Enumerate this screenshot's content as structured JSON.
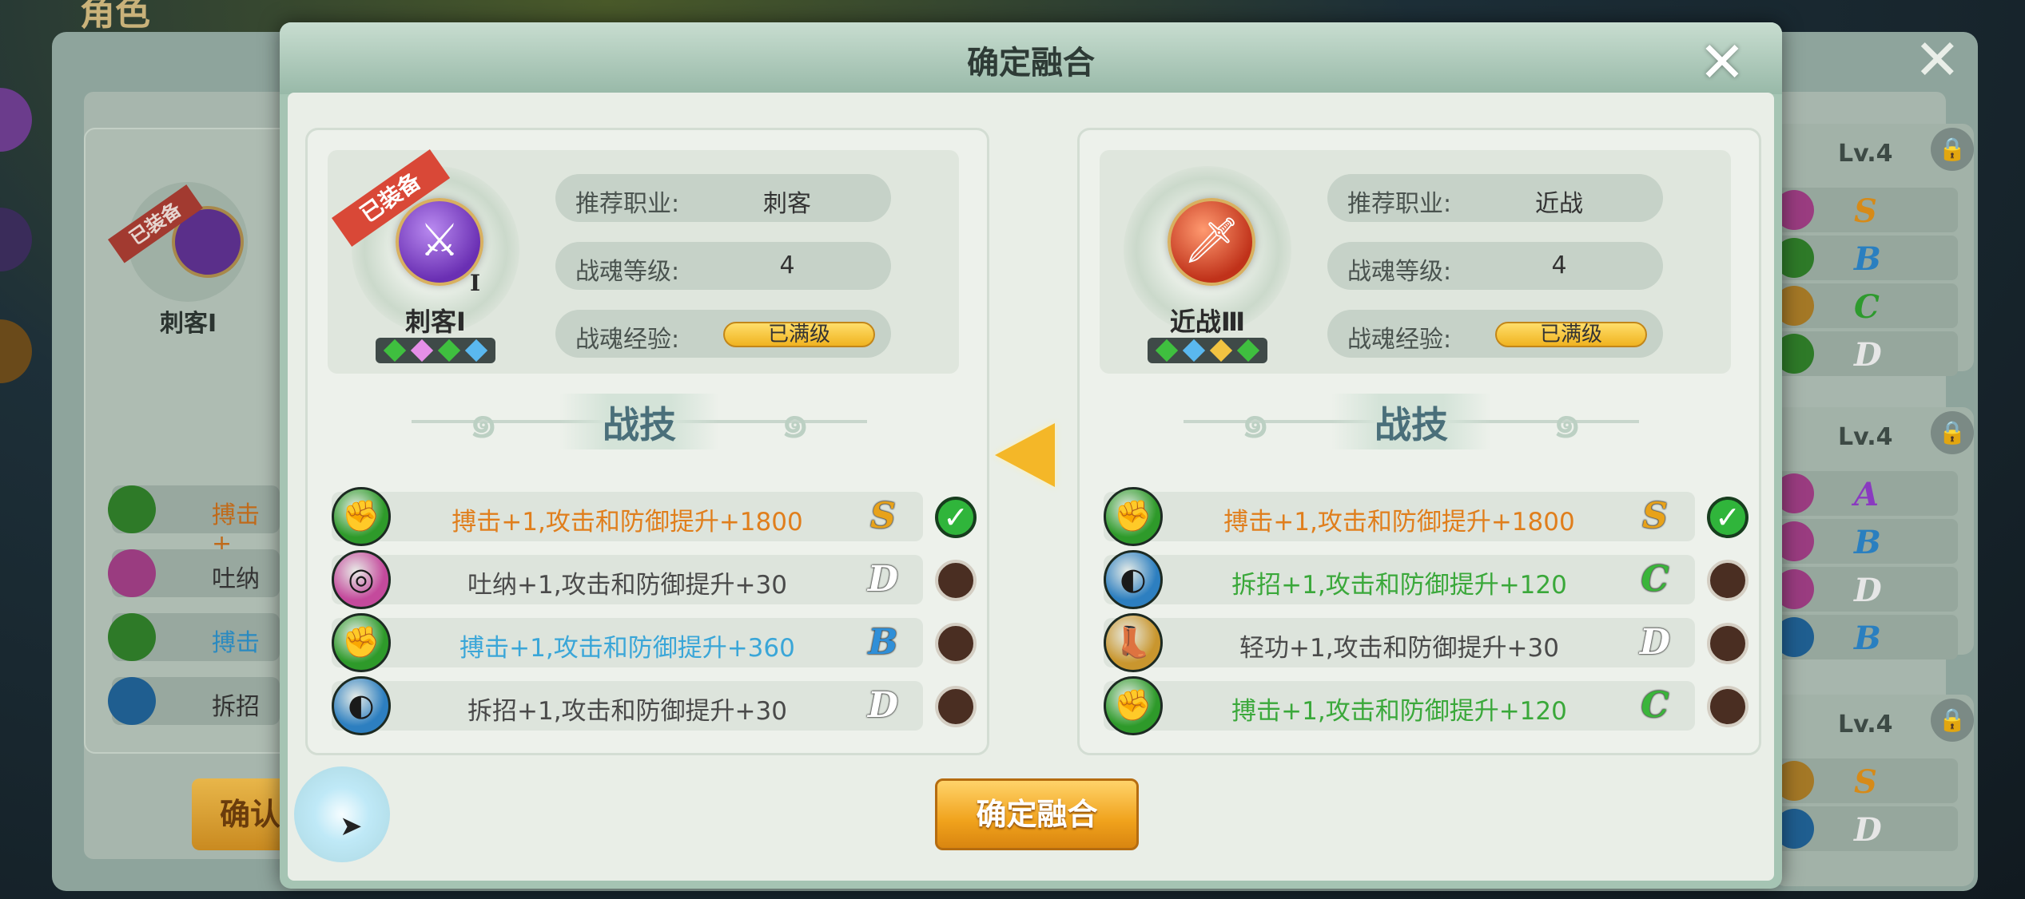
{
  "background": {
    "title_partial": "角色",
    "confirm_partial": "确认",
    "left_card": {
      "class_name": "刺客Ⅰ",
      "ribbon": "已装备",
      "rows": [
        "搏击+",
        "吐纳",
        "搏击",
        "拆招"
      ]
    },
    "right_columns": [
      {
        "level": "Lv.4",
        "grades": [
          "S",
          "B",
          "C",
          "D"
        ]
      },
      {
        "level": "Lv.4",
        "grades": [
          "A",
          "B",
          "D",
          "B"
        ]
      },
      {
        "level": "Lv.4",
        "grades": [
          "S",
          "D"
        ]
      }
    ]
  },
  "dialog": {
    "title": "确定融合",
    "close_icon": "close-x-icon",
    "confirm_label": "确定融合",
    "arrow_icon": "arrow-left-icon"
  },
  "left": {
    "ribbon": "已装备",
    "class_name": "刺客Ⅰ",
    "roman": "Ⅰ",
    "medal_icon": "crossed-daggers-icon",
    "gems": [
      "#3fbf3f",
      "#e58fe8",
      "#3fbf3f",
      "#5ab8ef"
    ],
    "stats": {
      "job_label": "推荐职业:",
      "job_value": "刺客",
      "level_label": "战魂等级:",
      "level_value": "4",
      "exp_label": "战魂经验:",
      "exp_value": "已满级"
    },
    "skills_title": "战技",
    "skills": [
      {
        "text": "搏击+1,攻击和防御提升+1800",
        "grade": "S",
        "color": "#e07e1c",
        "icon": "fist-icon",
        "icon_color": "#2e9a2a",
        "grade_color": "#e8a21a",
        "selected": true
      },
      {
        "text": "吐纳+1,攻击和防御提升+30",
        "grade": "D",
        "color": "#4a4a4a",
        "icon": "swirl-icon",
        "icon_color": "#c44a9c",
        "grade_color": "#ffffff",
        "selected": false
      },
      {
        "text": "搏击+1,攻击和防御提升+360",
        "grade": "B",
        "color": "#3aa6d8",
        "icon": "fist-icon",
        "icon_color": "#2e9a2a",
        "grade_color": "#2f8fd8",
        "selected": false
      },
      {
        "text": "拆招+1,攻击和防御提升+30",
        "grade": "D",
        "color": "#4a4a4a",
        "icon": "parry-icon",
        "icon_color": "#2d7fc0",
        "grade_color": "#ffffff",
        "selected": false
      }
    ]
  },
  "right": {
    "class_name": "近战Ⅲ",
    "medal_icon": "sword-icon",
    "gems": [
      "#3fbf3f",
      "#5ab8ef",
      "#f2c341",
      "#3fbf3f"
    ],
    "stats": {
      "job_label": "推荐职业:",
      "job_value": "近战",
      "level_label": "战魂等级:",
      "level_value": "4",
      "exp_label": "战魂经验:",
      "exp_value": "已满级"
    },
    "skills_title": "战技",
    "skills": [
      {
        "text": "搏击+1,攻击和防御提升+1800",
        "grade": "S",
        "color": "#e07e1c",
        "icon": "fist-icon",
        "icon_color": "#2e9a2a",
        "grade_color": "#e8a21a",
        "selected": true
      },
      {
        "text": "拆招+1,攻击和防御提升+120",
        "grade": "C",
        "color": "#3aa83a",
        "icon": "parry-icon",
        "icon_color": "#2d7fc0",
        "grade_color": "#3ab53a",
        "selected": false
      },
      {
        "text": "轻功+1,攻击和防御提升+30",
        "grade": "D",
        "color": "#4a4a4a",
        "icon": "boot-icon",
        "icon_color": "#c9962e",
        "grade_color": "#ffffff",
        "selected": false
      },
      {
        "text": "搏击+1,攻击和防御提升+120",
        "grade": "C",
        "color": "#3aa83a",
        "icon": "fist-icon",
        "icon_color": "#2e9a2a",
        "grade_color": "#3ab53a",
        "selected": false
      }
    ]
  }
}
